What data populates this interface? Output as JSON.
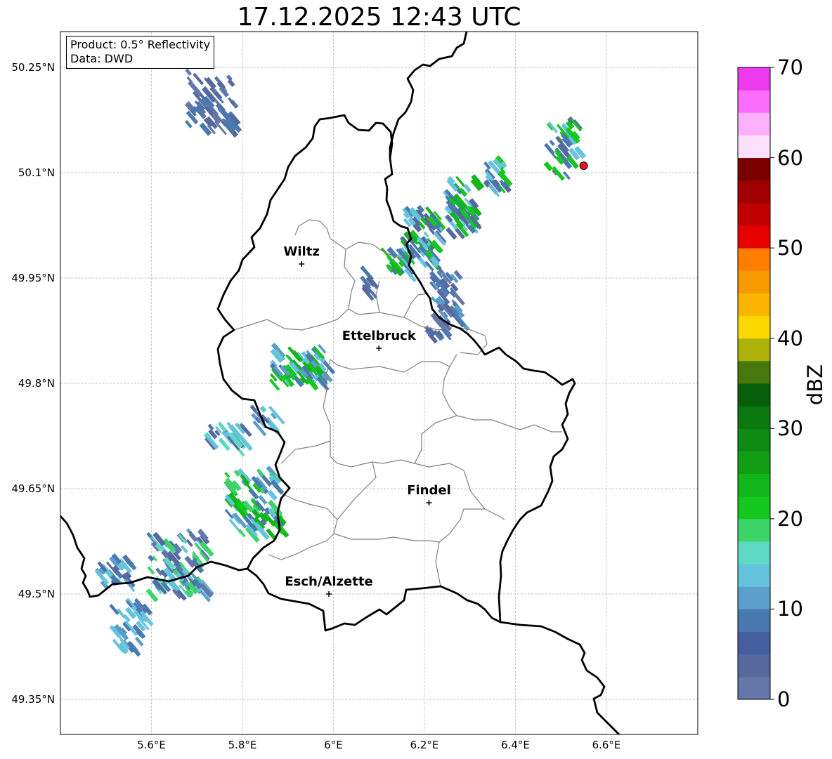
{
  "title": "17.12.2025 12:43 UTC",
  "info_box": {
    "product": "Product: 0.5° Reflectivity",
    "data": "Data: DWD"
  },
  "map": {
    "lon_range": [
      5.4,
      6.8
    ],
    "lat_range": [
      49.3,
      50.3
    ],
    "y_ticks": [
      {
        "value": 50.25,
        "label": "50.25°N"
      },
      {
        "value": 50.1,
        "label": "50.1°N"
      },
      {
        "value": 49.95,
        "label": "49.95°N"
      },
      {
        "value": 49.8,
        "label": "49.8°N"
      },
      {
        "value": 49.65,
        "label": "49.65°N"
      },
      {
        "value": 49.5,
        "label": "49.5°N"
      },
      {
        "value": 49.35,
        "label": "49.35°N"
      }
    ],
    "x_ticks": [
      {
        "value": 5.6,
        "label": "5.6°E"
      },
      {
        "value": 5.8,
        "label": "5.8°E"
      },
      {
        "value": 6.0,
        "label": "6°E"
      },
      {
        "value": 6.2,
        "label": "6.2°E"
      },
      {
        "value": 6.4,
        "label": "6.4°E"
      },
      {
        "value": 6.6,
        "label": "6.6°E"
      }
    ],
    "cities": [
      {
        "name": "Wiltz",
        "lon": 5.93,
        "lat": 49.97
      },
      {
        "name": "Ettelbruck",
        "lon": 6.1,
        "lat": 49.85
      },
      {
        "name": "Findel",
        "lon": 6.21,
        "lat": 49.63
      },
      {
        "name": "Esch/Alzette",
        "lon": 5.99,
        "lat": 49.5
      }
    ],
    "radar_site": {
      "lon": 6.55,
      "lat": 50.11,
      "color": "#e8141c"
    }
  },
  "colorbar": {
    "label": "dBZ",
    "min": 0,
    "max": 70,
    "step": 2.5,
    "ticks": [
      "0",
      "10",
      "20",
      "30",
      "40",
      "50",
      "60",
      "70"
    ],
    "colors": [
      "#6477a8",
      "#56699f",
      "#455ea0",
      "#4a78b0",
      "#5a9ec9",
      "#66c3dd",
      "#5dd9c3",
      "#3dd46a",
      "#14c81e",
      "#11b61a",
      "#119e14",
      "#0f8a12",
      "#0b7810",
      "#075f0b",
      "#46780c",
      "#adb10a",
      "#fdd800",
      "#fbb500",
      "#f79a00",
      "#ff7e00",
      "#e60000",
      "#c00000",
      "#a00000",
      "#7a0000",
      "#fde0fd",
      "#fcb0fc",
      "#fb6efb",
      "#ec3aec"
    ]
  }
}
